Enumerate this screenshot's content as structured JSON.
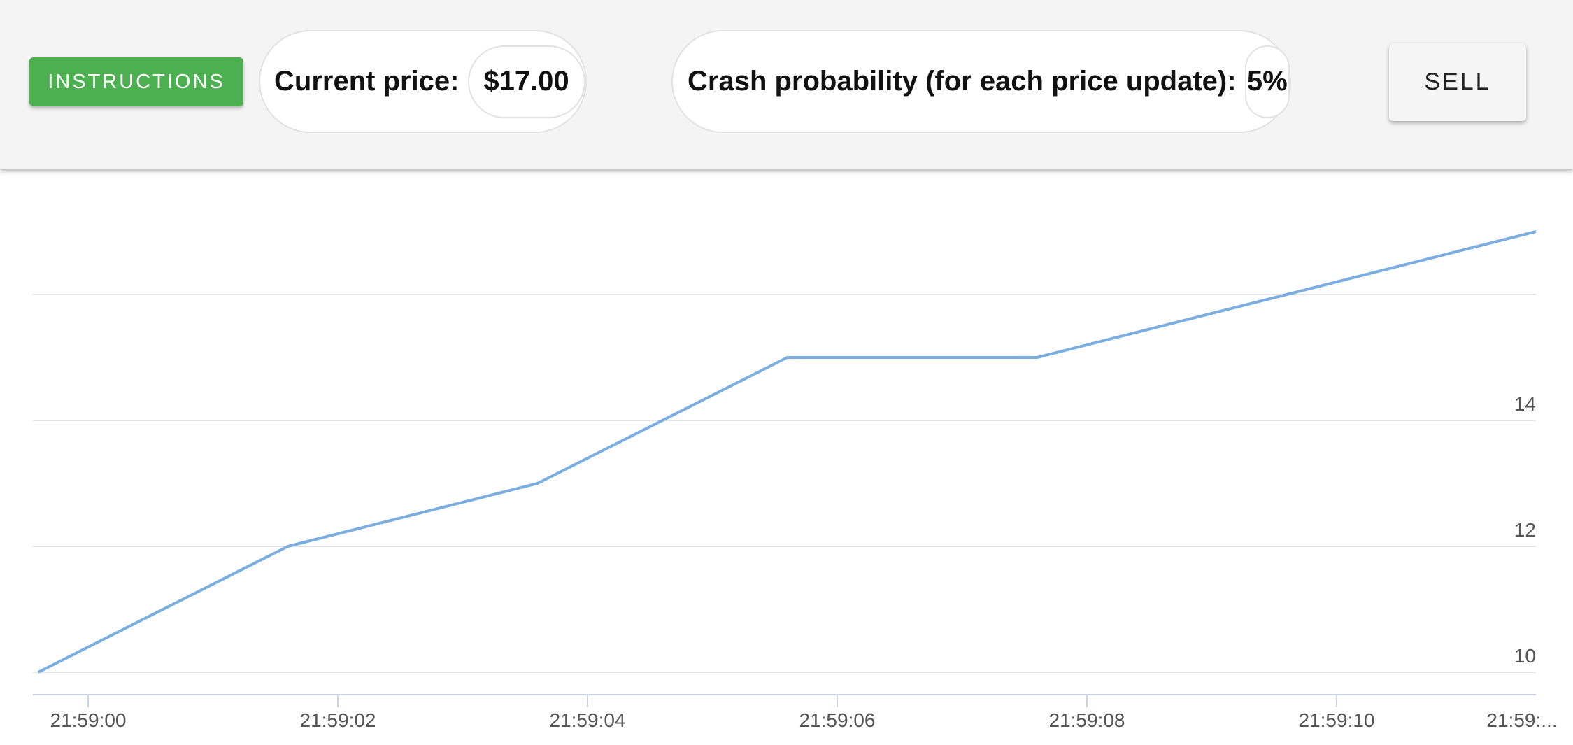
{
  "toolbar": {
    "instructions_label": "INSTRUCTIONS",
    "current_price_label": "Current price:",
    "current_price_value": "$17.00",
    "crash_probability_label": "Crash probability (for each price update):",
    "crash_probability_value": "5%",
    "sell_label": "SELL"
  },
  "colors": {
    "accent_green": "#4caf50",
    "line_blue": "#7aaee0",
    "grid": "#e3e3e3",
    "toolbar_bg": "#f4f4f4"
  },
  "chart_data": {
    "type": "line",
    "title": "",
    "xlabel": "",
    "ylabel": "",
    "x_ticks": [
      "21:59:00",
      "21:59:02",
      "21:59:04",
      "21:59:06",
      "21:59:08",
      "21:59:10",
      "21:59:..."
    ],
    "y_ticks": [
      10,
      12,
      14
    ],
    "grid": true,
    "series": [
      {
        "x": [
          "21:58:59.6",
          "21:59:01.6",
          "21:59:03.6",
          "21:59:05.6",
          "21:59:07.6",
          "21:59:09.6",
          "21:59:11.6"
        ],
        "values": [
          10,
          12,
          13,
          15,
          15,
          16,
          17
        ]
      }
    ]
  }
}
